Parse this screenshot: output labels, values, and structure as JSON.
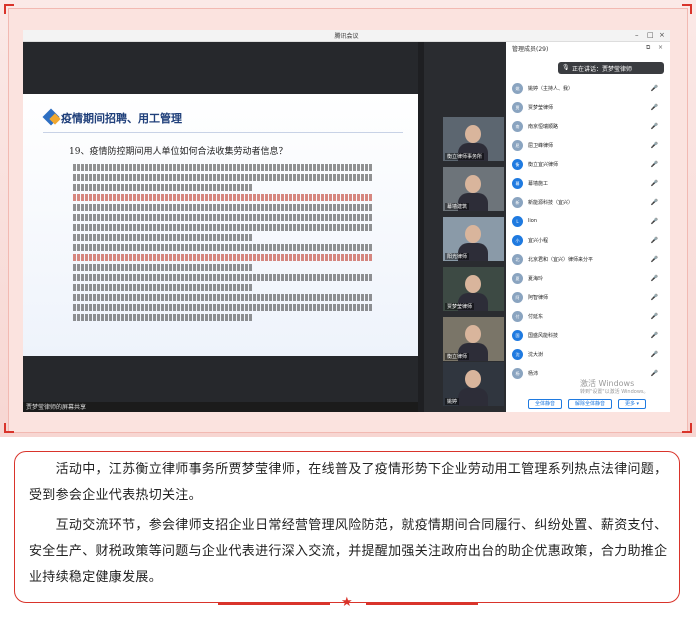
{
  "window": {
    "title": "腾讯会议",
    "controls": [
      "–",
      "□",
      "×"
    ]
  },
  "slide": {
    "heading": "疫情期间招聘、用工管理",
    "question": "19、疫情防控期间用人单位如何合法收集劳动者信息？"
  },
  "share_banner": "贾梦莹律师的屏幕共享",
  "tiles": [
    {
      "name": "衡立律师事务所"
    },
    {
      "name": "幕墙建筑"
    },
    {
      "name": "阳光律师"
    },
    {
      "name": "贾梦莹律师"
    },
    {
      "name": "衡立律师"
    },
    {
      "name": "姚婷"
    }
  ],
  "panel": {
    "header": "管理成员(29)",
    "speaking": "正在讲话：贾梦莹律师",
    "members": [
      {
        "name": "姚婷（主持人、我）",
        "avatar": "姚",
        "muted": true
      },
      {
        "name": "贾梦莹律师",
        "avatar": "贾",
        "muted": false
      },
      {
        "name": "南京恒瑞顺路",
        "avatar": "南",
        "muted": false
      },
      {
        "name": "屈卫峰律师",
        "avatar": "屈",
        "muted": true
      },
      {
        "name": "衡立宜兴律师",
        "avatar": "衡",
        "muted": true
      },
      {
        "name": "幕墙施工",
        "avatar": "幕",
        "muted": true
      },
      {
        "name": "新能源科技（宜兴）",
        "avatar": "新",
        "muted": true
      },
      {
        "name": "lion",
        "avatar": "L",
        "muted": true
      },
      {
        "name": "宜兴小程",
        "avatar": "小",
        "muted": true
      },
      {
        "name": "北京君和（宜兴）律师来分平",
        "avatar": "北",
        "muted": true
      },
      {
        "name": "夏海玲",
        "avatar": "夏",
        "muted": true
      },
      {
        "name": "阿智律师",
        "avatar": "阿",
        "muted": true
      },
      {
        "name": "付延东",
        "avatar": "付",
        "muted": true
      },
      {
        "name": "国盛风能科技",
        "avatar": "国",
        "muted": true
      },
      {
        "name": "沈大澍",
        "avatar": "沈",
        "muted": true
      },
      {
        "name": "杨沛",
        "avatar": "杨",
        "muted": true
      }
    ],
    "mute_all": "全体静音",
    "unmute_all": "解除全体静音",
    "more": "更多 ▾"
  },
  "watermark": {
    "line1": "激活 Windows",
    "line2": "转到\"设置\"以激活 Windows。"
  },
  "article": {
    "p1": "活动中，江苏衡立律师事务所贾梦莹律师，在线普及了疫情形势下企业劳动用工管理系列热点法律问题，受到参会企业代表热切关注。",
    "p2": "互动交流环节，参会律师支招企业日常经营管理风险防范，就疫情期间合同履行、纠纷处置、薪资支付、安全生产、财税政策等问题与企业代表进行深入交流，并提醒加强关注政府出台的助企优惠政策，合力助推企业持续稳定健康发展。"
  },
  "colors": {
    "accent": "#d9342b",
    "frame_bg": "#fbe3df",
    "link": "#1f7ae0"
  }
}
